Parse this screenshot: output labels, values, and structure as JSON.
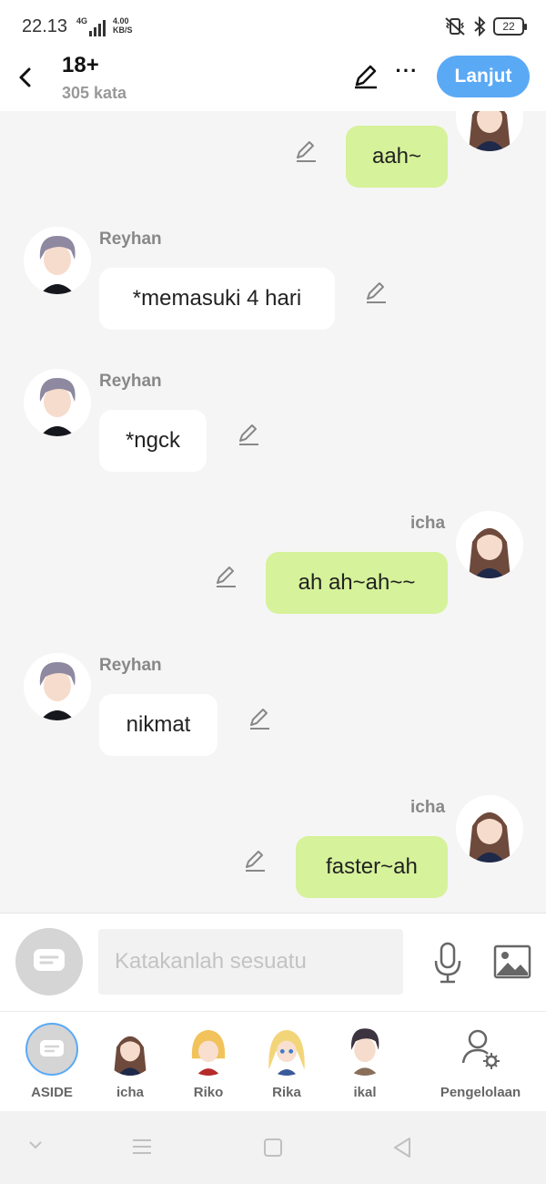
{
  "status": {
    "time": "22.13",
    "network": "4G",
    "speed_value": "4.00",
    "speed_unit": "KB/S",
    "battery": "22"
  },
  "header": {
    "title": "18+",
    "subtitle": "305 kata",
    "next_label": "Lanjut"
  },
  "messages": [
    {
      "side": "right",
      "sender": "",
      "text": "aah~"
    },
    {
      "side": "left",
      "sender": "Reyhan",
      "text": "*memasuki 4 hari"
    },
    {
      "side": "left",
      "sender": "Reyhan",
      "text": "*ngck"
    },
    {
      "side": "right",
      "sender": "icha",
      "text": "ah ah~ah~~"
    },
    {
      "side": "left",
      "sender": "Reyhan",
      "text": "nikmat"
    },
    {
      "side": "right",
      "sender": "icha",
      "text": "faster~ah"
    }
  ],
  "composer": {
    "placeholder": "Katakanlah sesuatu"
  },
  "characters": [
    {
      "name": "ASIDE"
    },
    {
      "name": "icha"
    },
    {
      "name": "Riko"
    },
    {
      "name": "Rika"
    },
    {
      "name": "ikal"
    }
  ],
  "manage_label": "Pengelolaan",
  "colors": {
    "accent": "#5aa9f5",
    "right_bubble": "#d6f29a",
    "left_bubble": "#ffffff"
  }
}
